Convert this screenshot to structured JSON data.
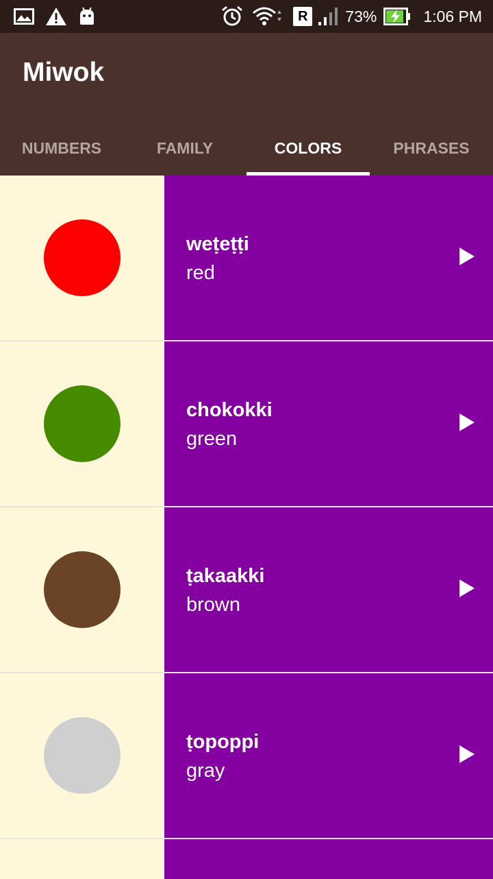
{
  "status_bar": {
    "battery": "73%",
    "time": "1:06 PM",
    "carrier_badge": "R",
    "icons": [
      "image-icon",
      "warning-icon",
      "android-icon",
      "alarm-icon",
      "wifi-icon",
      "signal-icon",
      "battery-charging-icon"
    ]
  },
  "app": {
    "title": "Miwok"
  },
  "tabs": [
    {
      "label": "NUMBERS"
    },
    {
      "label": "FAMILY"
    },
    {
      "label": "COLORS"
    },
    {
      "label": "PHRASES"
    }
  ],
  "active_tab": "COLORS",
  "colors": {
    "row_bg": "#8500A0",
    "swatch_bg": "#FFF7DA",
    "app_bar": "#4A312C",
    "status_bar": "#2B1C17"
  },
  "items": [
    {
      "miwok": "weṭeṭṭi",
      "english": "red",
      "swatch": "#FF0000"
    },
    {
      "miwok": "chokokki",
      "english": "green",
      "swatch": "#458B00"
    },
    {
      "miwok": "ṭakaakki",
      "english": "brown",
      "swatch": "#6B4428"
    },
    {
      "miwok": "ṭopoppi",
      "english": "gray",
      "swatch": "#CFCFCF"
    }
  ]
}
